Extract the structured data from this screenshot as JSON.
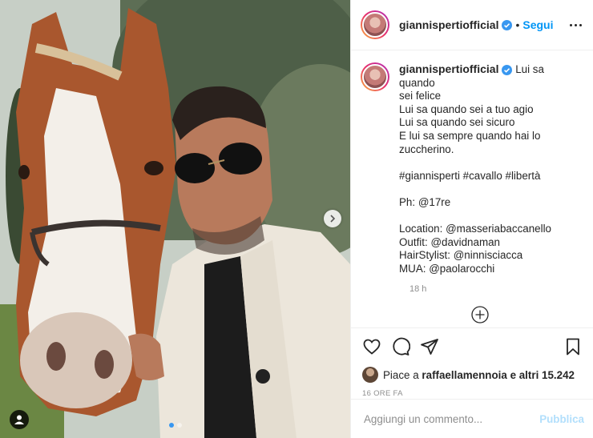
{
  "post": {
    "username": "giannispertiofficial",
    "verified": true,
    "follow_separator": "•",
    "follow_label": "Segui",
    "more_icon": "more-options-icon"
  },
  "caption": {
    "username": "giannispertiofficial",
    "lines": [
      "Lui sa quando",
      "sei felice",
      "Lui sa quando sei a tuo agio",
      "Lui sa quando sei sicuro",
      "E lui sa sempre quando hai lo",
      "zuccherino.",
      "",
      "#giannisperti #cavallo #libertà",
      "",
      "Ph: @17re",
      "",
      "Location: @masseriabaccanello",
      "Outfit: @davidnaman",
      "HairStylist: @ninnisciacca",
      "MUA: @paolarocchi"
    ],
    "time": "18 h"
  },
  "likes": {
    "prefix": "Piace a ",
    "user": "raffaellamennoia",
    "suffix": " e altri 15.242"
  },
  "post_time": "16 ORE FA",
  "comment_box": {
    "placeholder": "Aggiungi un commento...",
    "publish_label": "Pubblica"
  },
  "carousel": {
    "slides": 2,
    "active_index": 0
  },
  "colors": {
    "accent": "#0095f6",
    "publish_disabled": "#b2dffc",
    "muted": "#8e8e8e",
    "verified": "#3897f0"
  }
}
